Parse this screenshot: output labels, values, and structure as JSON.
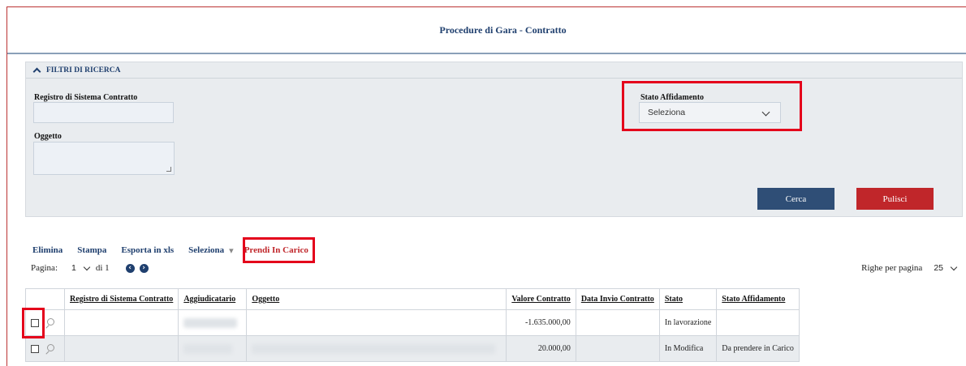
{
  "header": {
    "title": "Procedure di Gara - Contratto"
  },
  "filters": {
    "section_label": "FILTRI DI RICERCA",
    "registro_label": "Registro di Sistema Contratto",
    "registro_value": "",
    "oggetto_label": "Oggetto",
    "oggetto_value": "",
    "stato_label": "Stato Affidamento",
    "stato_selected": "Seleziona",
    "cerca_label": "Cerca",
    "pulisci_label": "Pulisci"
  },
  "toolbar": {
    "elimina": "Elimina",
    "stampa": "Stampa",
    "esporta": "Esporta in xls",
    "seleziona": "Seleziona",
    "seleziona_caret": "▾",
    "prendi": "Prendi In Carico"
  },
  "pagination": {
    "label": "Pagina:",
    "current": "1",
    "of_text": "di 1",
    "rows_label": "Righe per pagina",
    "rows_value": "25",
    "prev_glyph": "‹",
    "next_glyph": "›"
  },
  "table": {
    "headers": {
      "registro": "Registro di Sistema Contratto",
      "aggiudicatario": "Aggiudicatario",
      "oggetto": "Oggetto",
      "valore": "Valore Contratto",
      "data_invio": "Data Invio Contratto",
      "stato": "Stato",
      "stato_affidamento": "Stato Affidamento"
    },
    "rows": [
      {
        "registro": "",
        "valore": "-1.635.000,00",
        "data_invio": "",
        "stato": "In lavorazione",
        "stato_affidamento": ""
      },
      {
        "registro": "",
        "valore": "20.000,00",
        "data_invio": "",
        "stato": "In Modifica",
        "stato_affidamento": "Da prendere in Carico"
      }
    ]
  },
  "colors": {
    "accent": "#1f3f6e",
    "cerca": "#2f4e76",
    "pulisci": "#c0262a",
    "highlight": "#e4001b"
  }
}
